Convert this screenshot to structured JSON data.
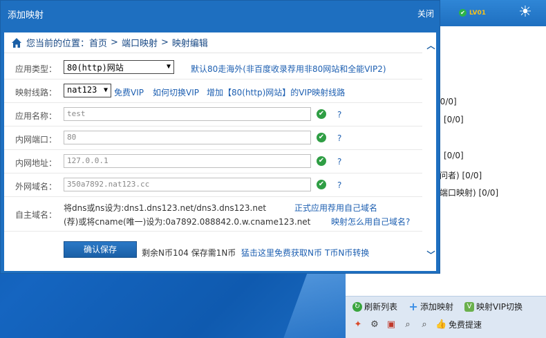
{
  "app": {
    "title": "添加映射",
    "close_label": "关闭",
    "level_badge": "LV01",
    "bg_list": [
      "[0/0]",
      "[0/0]",
      "[0/0]",
      "问者)   [0/0]",
      "端口映射)   [0/0]"
    ],
    "toolbar": {
      "refresh_label": "刷新列表",
      "add_label": "添加映射",
      "vip_label": "映射VIP切换",
      "free_speed_label": "免费提速"
    }
  },
  "dialog": {
    "title": "添加映射",
    "close_label": "关闭",
    "breadcrumb": {
      "prefix": "您当前的位置：",
      "items": [
        "首页",
        "端口映射",
        "映射编辑"
      ],
      "separator": ">"
    },
    "fields": {
      "app_type": {
        "label": "应用类型：",
        "selected": "80(http)网站",
        "hint": "默认80走海外(非百度收录荐用非80网站和全能VIP2)"
      },
      "route": {
        "label": "映射线路：",
        "selected": "nat123",
        "links": [
          "免费VIP",
          "如何切换VIP",
          "增加【80(http)网站】的VIP映射线路"
        ]
      },
      "app_name": {
        "label": "应用名称：",
        "value": "test",
        "help": "?"
      },
      "lan_port": {
        "label": "内网端口：",
        "value": "80",
        "help": "?"
      },
      "lan_addr": {
        "label": "内网地址：",
        "value": "127.0.0.1",
        "help": "?"
      },
      "wan_domain": {
        "label": "外网域名：",
        "value": "350a7892.nat123.cc",
        "help": "?"
      },
      "custom_domain": {
        "label": "自主域名：",
        "line1": "将dns或ns设为:dns1.dns123.net/dns3.dns123.net",
        "line1_link": "正式应用荐用自己域名",
        "line2": "(荐)或将cname(唯一)设为:0a7892.088842.0.w.cname123.net",
        "line2_link": "映射怎么用自己域名?"
      }
    },
    "save": {
      "button_label": "确认保存",
      "info": "剩余N币104 保存需1N币",
      "link1": "猛击这里免费获取N币",
      "link2": "T币N币转换"
    }
  }
}
